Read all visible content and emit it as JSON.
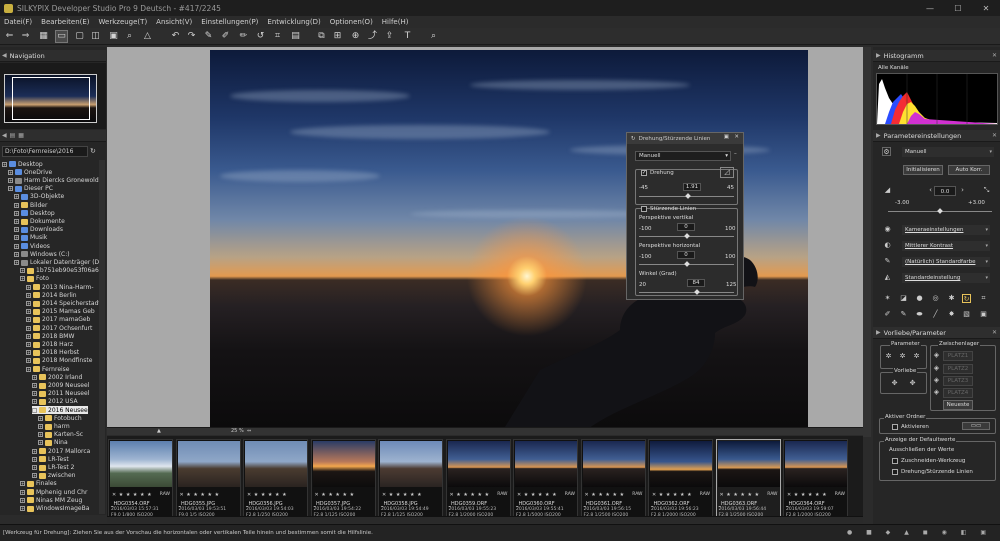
{
  "window": {
    "title": "SILKYPIX Developer Studio Pro 9 Deutsch - #417/2245",
    "buttons": [
      "minimize",
      "maximize",
      "close"
    ]
  },
  "menu": [
    "Datei(F)",
    "Bearbeiten(E)",
    "Werkzeuge(T)",
    "Ansicht(V)",
    "Einstellungen(P)",
    "Entwicklung(D)",
    "Optionen(O)",
    "Hilfe(H)"
  ],
  "toolbar_icons": [
    "open-icon",
    "save-icon",
    "grid-view-icon",
    "single-view-icon",
    "compare-view-icon",
    "full-view-icon",
    "split-view-icon",
    "fit-icon",
    "zoom-icon",
    "warning-icon",
    "undo-icon",
    "redo-icon",
    "eyedropper-icon",
    "wb-picker-icon",
    "spot-icon",
    "rotate-icon",
    "crop-icon",
    "ruler-icon",
    "copy-params-icon",
    "paste-params-icon",
    "stamp-icon",
    "export-icon",
    "develop-icon",
    "print-icon",
    "text-icon",
    "search-icon"
  ],
  "left": {
    "navigation_title": "Navigation",
    "path": "D:\\Foto\\Fernreise\\2016",
    "tree": [
      {
        "label": "Desktop",
        "icon": "b",
        "indent": 0
      },
      {
        "label": "OneDrive",
        "icon": "b",
        "indent": 1
      },
      {
        "label": "Harm Diercks Gronewold",
        "icon": "d",
        "indent": 1
      },
      {
        "label": "Dieser PC",
        "icon": "b",
        "indent": 1
      },
      {
        "label": "3D-Objekte",
        "icon": "b",
        "indent": 2
      },
      {
        "label": "Bilder",
        "icon": "y",
        "indent": 2
      },
      {
        "label": "Desktop",
        "icon": "b",
        "indent": 2
      },
      {
        "label": "Dokumente",
        "icon": "y",
        "indent": 2
      },
      {
        "label": "Downloads",
        "icon": "b",
        "indent": 2
      },
      {
        "label": "Musik",
        "icon": "b",
        "indent": 2
      },
      {
        "label": "Videos",
        "icon": "b",
        "indent": 2
      },
      {
        "label": "Windows (C:)",
        "icon": "d",
        "indent": 2
      },
      {
        "label": "Lokaler Datenträger (D:)",
        "icon": "d",
        "indent": 2
      },
      {
        "label": "1b751eb90e53f06a6e",
        "icon": "y",
        "indent": 3
      },
      {
        "label": "Foto",
        "icon": "y",
        "indent": 3
      },
      {
        "label": "2013 Nina-Harm-",
        "icon": "y",
        "indent": 4
      },
      {
        "label": "2014 Berlin",
        "icon": "y",
        "indent": 4
      },
      {
        "label": "2014 Speicherstadt",
        "icon": "y",
        "indent": 4
      },
      {
        "label": "2015 Mamas Geb",
        "icon": "y",
        "indent": 4
      },
      {
        "label": "2017 mamaGeb",
        "icon": "y",
        "indent": 4
      },
      {
        "label": "2017 Ochsenfurt",
        "icon": "y",
        "indent": 4
      },
      {
        "label": "2018 BMW",
        "icon": "y",
        "indent": 4
      },
      {
        "label": "2018 Harz",
        "icon": "y",
        "indent": 4
      },
      {
        "label": "2018 Herbst",
        "icon": "y",
        "indent": 4
      },
      {
        "label": "2018 Mondfinste",
        "icon": "y",
        "indent": 4
      },
      {
        "label": "Fernreise",
        "icon": "y",
        "indent": 4
      },
      {
        "label": "2002 Irland",
        "icon": "y",
        "indent": 5
      },
      {
        "label": "2009 Neuseel",
        "icon": "y",
        "indent": 5
      },
      {
        "label": "2011 Neuseel",
        "icon": "y",
        "indent": 5
      },
      {
        "label": "2012 USA",
        "icon": "y",
        "indent": 5
      },
      {
        "label": "2016 Neusee",
        "icon": "y",
        "indent": 5,
        "selected": true
      },
      {
        "label": "Fotobuch",
        "icon": "y",
        "indent": 6
      },
      {
        "label": "harm",
        "icon": "y",
        "indent": 6
      },
      {
        "label": "Karten-Sc",
        "icon": "y",
        "indent": 6
      },
      {
        "label": "Nina",
        "icon": "y",
        "indent": 6
      },
      {
        "label": "2017 Mallorca",
        "icon": "y",
        "indent": 5
      },
      {
        "label": "LR-Test",
        "icon": "y",
        "indent": 5
      },
      {
        "label": "LR-Test 2",
        "icon": "y",
        "indent": 5
      },
      {
        "label": "zwischen",
        "icon": "y",
        "indent": 5
      },
      {
        "label": "Finales",
        "icon": "y",
        "indent": 3
      },
      {
        "label": "Mphenig und Chr",
        "icon": "y",
        "indent": 3
      },
      {
        "label": "Ninas MM Zeug",
        "icon": "y",
        "indent": 3
      },
      {
        "label": "WindowsImageBa",
        "icon": "y",
        "indent": 3
      }
    ]
  },
  "preview": {
    "zoom_label": "25 %"
  },
  "rotation_dialog": {
    "title": "Drehung/Stürzende Linien",
    "preset": "Manuell",
    "drehung_label": "Drehung",
    "drehung_checked": true,
    "drehung_min": "-45",
    "drehung_value": "1.91",
    "drehung_max": "45",
    "drehung_level": 0.52,
    "stuerzende_label": "Stürzende Linien",
    "stuerzende_checked": false,
    "vertikal_label": "Perspektive vertikal",
    "vertikal_min": "-100",
    "vertikal_value": "0",
    "vertikal_max": "100",
    "vertikal_level": 0.5,
    "horizontal_label": "Perspektive horizontal",
    "horizontal_min": "-100",
    "horizontal_value": "0",
    "horizontal_max": "100",
    "horizontal_level": 0.5,
    "winkel_label": "Winkel (Grad)",
    "winkel_min": "20",
    "winkel_value": "84",
    "winkel_max": "125",
    "winkel_level": 0.61
  },
  "filmstrip": [
    {
      "name": "_HDG0354.ORF",
      "date": "2016/03/03 15:57:31",
      "exif": "F9.0 1/800 ISO200",
      "fmt": "RAW",
      "theme": "sky"
    },
    {
      "name": "_HDG0355.JPG",
      "date": "2016/03/03 19:53:51",
      "exif": "F9.0 1/5 ISO200",
      "fmt": "",
      "theme": "portrait"
    },
    {
      "name": "_HDG0356.JPG",
      "date": "2016/03/03 19:54:03",
      "exif": "F2.8 1/250 ISO200",
      "fmt": "",
      "theme": "portrait"
    },
    {
      "name": "_HDG0357.JPG",
      "date": "2016/03/03 19:54:22",
      "exif": "F2.8 1/125 ISO200",
      "fmt": "",
      "theme": "sunset-person"
    },
    {
      "name": "_HDG0358.JPG",
      "date": "2016/03/03 19:54:49",
      "exif": "F2.8 1/125 ISO200",
      "fmt": "",
      "theme": "couple"
    },
    {
      "name": "_HDG0359.ORF",
      "date": "2016/03/03 19:55:23",
      "exif": "F2.8 1/2000 ISO200",
      "fmt": "RAW",
      "theme": "sunset"
    },
    {
      "name": "_HDG0360.ORF",
      "date": "2016/03/03 19:55:41",
      "exif": "F2.8 1/5000 ISO200",
      "fmt": "RAW",
      "theme": "sunset"
    },
    {
      "name": "_HDG0361.ORF",
      "date": "2016/03/03 19:56:15",
      "exif": "F2.8 1/2500 ISO200",
      "fmt": "RAW",
      "theme": "sunset"
    },
    {
      "name": "_HDG0362.ORF",
      "date": "2016/03/03 19:56:23",
      "exif": "F2.8 1/2000 ISO200",
      "fmt": "RAW",
      "theme": "sunset-tall"
    },
    {
      "name": "_HDG0363.ORF",
      "date": "2016/03/03 19:56:44",
      "exif": "F2.8 1/2500 ISO200",
      "fmt": "RAW",
      "theme": "hand",
      "selected": true
    },
    {
      "name": "_HDG0364.ORF",
      "date": "2016/03/03 19:59:07",
      "exif": "F2.8 1/2000 ISO200",
      "fmt": "RAW",
      "theme": "sunset"
    }
  ],
  "right": {
    "histogram_title": "Histogramm",
    "histogram_channel": "Alle Kanäle",
    "params_title": "Parametereinstellungen",
    "preset": "Manuell",
    "initialize_btn": "Initialisieren",
    "autokorr_btn": "Auto Korr.",
    "exposure_value": "0.0",
    "exposure_min": "-3.00",
    "exposure_max": "+3.00",
    "exposure_level": 0.5,
    "dropdowns": [
      "Kameraeinstellungen",
      "Mittlerer Kontrast",
      "(Natürlich) Standardfarbe",
      "Standardeinstellung"
    ],
    "vorliebe_title": "Vorliebe/Parameter",
    "parameter_label": "Parameter",
    "zwischenlager_label": "Zwischenlager",
    "platz_labels": [
      "PLATZ1",
      "PLATZ2",
      "PLATZ3",
      "PLATZ4"
    ],
    "vorliebe_label": "Vorliebe",
    "neueste_btn": "Neueste",
    "aktiver_ordner_title": "Aktiver Ordner",
    "aktivieren_label": "Aktivieren",
    "anzeige_title": "Anzeige der Defaultwerte",
    "ausschliessen_label": "Ausschließen der Werte",
    "zuschneiden_label": "Zuschneiden-Werkzeug",
    "drehung_label": "Drehung/Stürzende Linien"
  },
  "status": "[Werkzeug für Drehung]: Ziehen Sie aus der Vorschau die horizontalen oder vertikalen Teile hinein und bestimmen somit die Hilfslinie.",
  "colors": {
    "accent_yellow": "#e8c35a",
    "panel_bg": "#262626",
    "preview_bg": "#a9a9a9"
  }
}
